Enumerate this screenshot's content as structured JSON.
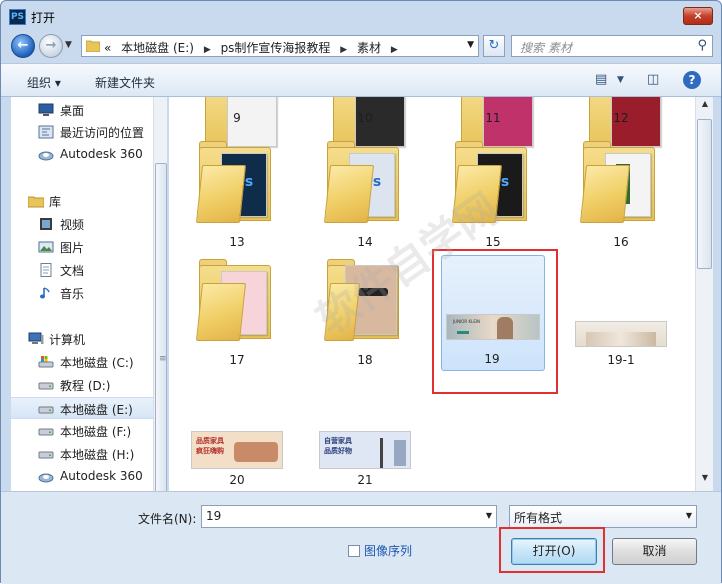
{
  "window": {
    "title": "打开",
    "app_icon": "PS",
    "close": "×"
  },
  "nav": {
    "back": "←",
    "forward": "→",
    "breadcrumbs": [
      "«",
      "本地磁盘 (E:)",
      "ps制作宣传海报教程",
      "素材"
    ],
    "search_placeholder": "搜索 素材",
    "refresh": "↻"
  },
  "toolbar": {
    "organize": "组织 ▾",
    "new_folder": "新建文件夹",
    "help": "?"
  },
  "sidebar": {
    "items": [
      {
        "label": "桌面",
        "icon": "desktop-icon"
      },
      {
        "label": "最近访问的位置",
        "icon": "recent-icon"
      },
      {
        "label": "Autodesk 360",
        "icon": "cloud-icon"
      },
      {
        "label": "库",
        "icon": "library-icon"
      },
      {
        "label": "视频",
        "icon": "video-icon"
      },
      {
        "label": "图片",
        "icon": "picture-icon"
      },
      {
        "label": "文档",
        "icon": "document-icon"
      },
      {
        "label": "音乐",
        "icon": "music-icon"
      },
      {
        "label": "计算机",
        "icon": "computer-icon"
      },
      {
        "label": "本地磁盘 (C:)",
        "icon": "drive-icon"
      },
      {
        "label": "教程 (D:)",
        "icon": "drive-icon"
      },
      {
        "label": "本地磁盘 (E:)",
        "icon": "drive-icon",
        "selected": true
      },
      {
        "label": "本地磁盘 (F:)",
        "icon": "drive-icon"
      },
      {
        "label": "本地磁盘 (H:)",
        "icon": "drive-icon"
      },
      {
        "label": "Autodesk 360",
        "icon": "cloud-icon"
      }
    ]
  },
  "files": {
    "row0": [
      "9",
      "10",
      "11",
      "12"
    ],
    "row1": [
      "13",
      "14",
      "15",
      "16"
    ],
    "row2": [
      "17",
      "18",
      "19",
      "19-1"
    ],
    "row3": [
      "20",
      "21"
    ],
    "selected": "19",
    "thumb_19_text": "JUNIOR KLEIN",
    "thumb_20_text": [
      "品质家具",
      "疯狂嗨购"
    ],
    "thumb_21_text": [
      "自营家具",
      "品质好物"
    ]
  },
  "bottom": {
    "filename_label": "文件名(N):",
    "filename_value": "19",
    "filetype": "所有格式",
    "image_sequence": "图像序列",
    "open": "打开(O)",
    "cancel": "取消"
  },
  "watermark": "软件自学网",
  "colors": {
    "highlight_box": "#e23030",
    "selection": "#cde3fb",
    "folder": "#f0cf66"
  }
}
